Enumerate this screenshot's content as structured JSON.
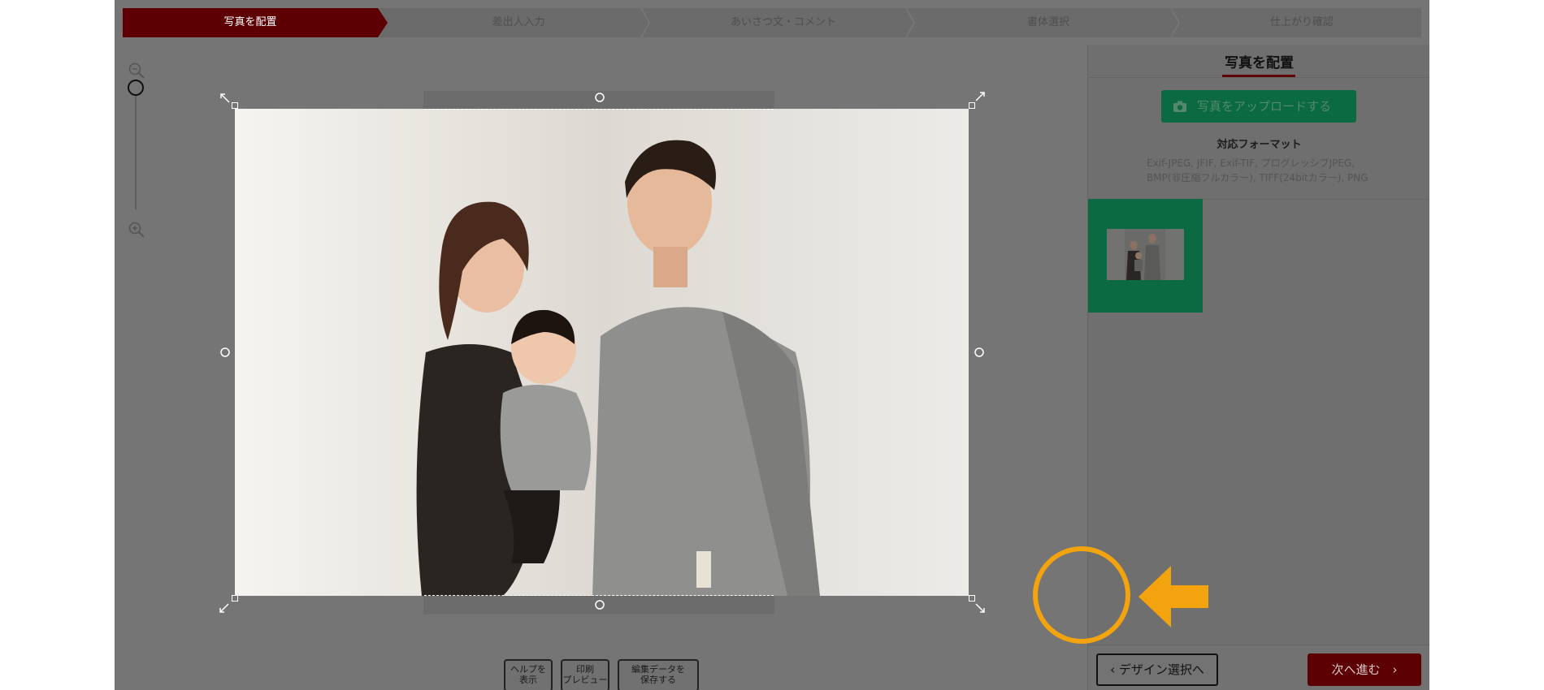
{
  "steps": [
    {
      "label": "写真を配置",
      "active": true
    },
    {
      "label": "差出人入力",
      "active": false
    },
    {
      "label": "あいさつ文・コメント",
      "active": false
    },
    {
      "label": "書体選択",
      "active": false
    },
    {
      "label": "仕上がり確認",
      "active": false
    }
  ],
  "zoom": {
    "out_icon": "zoom-out-icon",
    "in_icon": "zoom-in-icon",
    "level": 0.0
  },
  "toolbar": {
    "help_label": "ヘルプを\n表示",
    "print_label": "印刷\nプレビュー",
    "save_label": "編集データを\n保存する"
  },
  "panel": {
    "title": "写真を配置",
    "upload_label": "写真をアップロードする",
    "format_title": "対応フォーマット",
    "format_line1": "Exif-JPEG, JFIF, Exif-TIF, プログレッシブJPEG,",
    "format_line2": "BMP(非圧縮フルカラー), TIFF(24bitカラー), PNG",
    "back_label": "デザイン選択へ",
    "next_label": "次へ進む"
  },
  "colors": {
    "accent": "#5c0004",
    "upload_green": "#0b6a42",
    "annotation": "#f2a30e",
    "overlay_gray": "#757575"
  }
}
